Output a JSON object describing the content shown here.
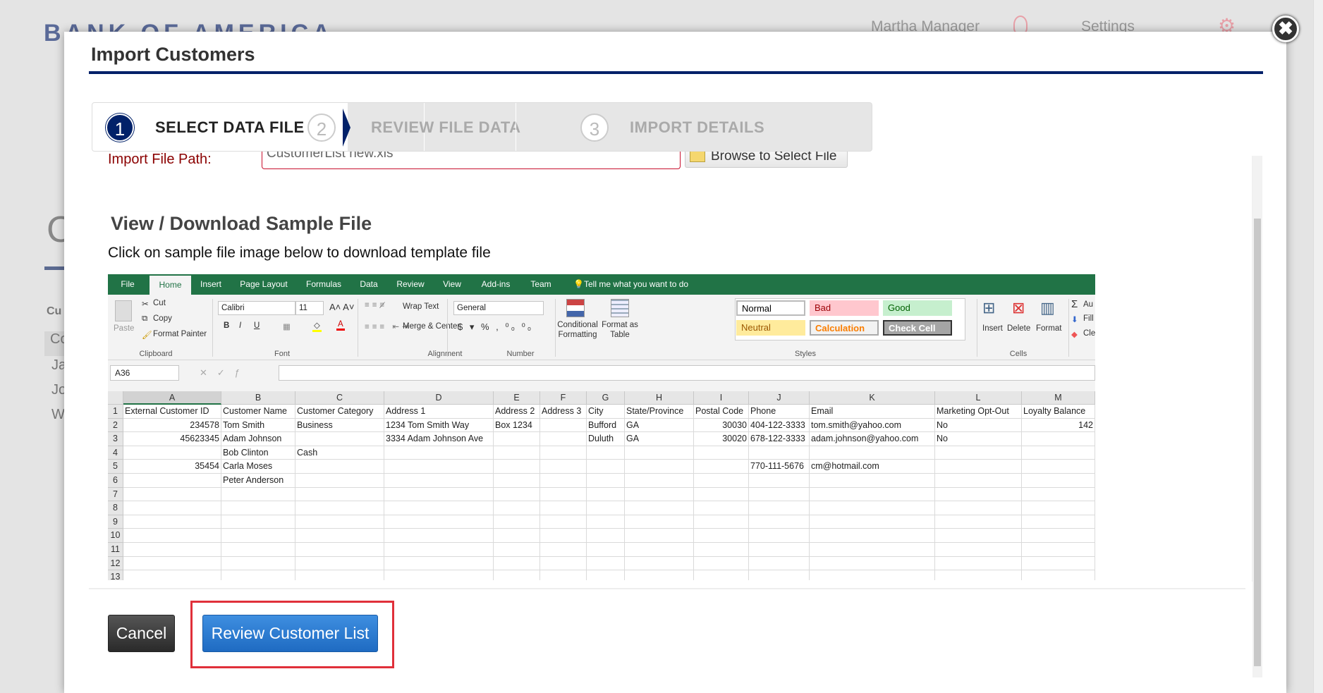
{
  "background": {
    "logo": "BANK OF AMERICA",
    "user_name": "Martha Manager",
    "settings_label": "Settings",
    "page_heading_partial": "C",
    "list_partial": [
      "Cu",
      "Co",
      "Ja",
      "Jo",
      "W"
    ]
  },
  "modal": {
    "title": "Import Customers",
    "close_label": "✖",
    "steps": [
      {
        "number": "1",
        "label": "SELECT DATA FILE",
        "active": true
      },
      {
        "number": "2",
        "label": "REVIEW FILE DATA",
        "active": false
      },
      {
        "number": "3",
        "label": "IMPORT DETAILS",
        "active": false
      }
    ],
    "import_path_label": "Import File Path:",
    "import_path_value": "CustomerList new.xls",
    "browse_label": "Browse to Select File",
    "sample_title": "View / Download Sample File",
    "sample_desc": "Click on sample file image below to download template file",
    "cancel_label": "Cancel",
    "review_label": "Review Customer List",
    "colors": {
      "navy": "#012169",
      "primary_button": "#2a7bd4",
      "highlight": "#e0303a",
      "excel_green": "#217346"
    }
  },
  "excel": {
    "tabs": [
      "File",
      "Home",
      "Insert",
      "Page Layout",
      "Formulas",
      "Data",
      "Review",
      "View",
      "Add-ins",
      "Team"
    ],
    "tell_me": "Tell me what you want to do",
    "clipboard": {
      "paste": "Paste",
      "cut": "Cut",
      "copy": "Copy",
      "format_painter": "Format Painter",
      "group": "Clipboard"
    },
    "font": {
      "name": "Calibri",
      "size": "11",
      "group": "Font"
    },
    "alignment": {
      "wrap": "Wrap Text",
      "merge": "Merge & Center",
      "group": "Alignment"
    },
    "number": {
      "format": "General",
      "group": "Number"
    },
    "styles": {
      "conditional": "Conditional Formatting",
      "format_table": "Format as Table",
      "normal": "Normal",
      "bad": "Bad",
      "good": "Good",
      "neutral": "Neutral",
      "calculation": "Calculation",
      "check_cell": "Check Cell",
      "group": "Styles"
    },
    "cells": {
      "insert": "Insert",
      "delete": "Delete",
      "format": "Format",
      "group": "Cells"
    },
    "editing": {
      "autosum": "Au",
      "fill": "Fill",
      "clear": "Cle"
    },
    "name_box": "A36",
    "columns": [
      "A",
      "B",
      "C",
      "D",
      "E",
      "F",
      "G",
      "H",
      "I",
      "J",
      "K",
      "L",
      "M"
    ],
    "row_numbers": [
      "1",
      "2",
      "3",
      "4",
      "5",
      "6",
      "7",
      "8",
      "9",
      "10",
      "11",
      "12",
      "13"
    ],
    "rows": [
      [
        "External Customer ID",
        "Customer Name",
        "Customer Category",
        "Address 1",
        "Address 2",
        "Address 3",
        "City",
        "State/Province",
        "Postal Code",
        "Phone",
        "Email",
        "Marketing Opt-Out",
        "Loyalty Balance"
      ],
      [
        "234578",
        "Tom Smith",
        "Business",
        "1234 Tom Smith Way",
        "Box 1234",
        "",
        "Bufford",
        "GA",
        "30030",
        "404-122-3333",
        "tom.smith@yahoo.com",
        "No",
        "142"
      ],
      [
        "45623345",
        "Adam Johnson",
        "",
        "3334 Adam Johnson Ave",
        "",
        "",
        "Duluth",
        "GA",
        "30020",
        "678-122-3333",
        "adam.johnson@yahoo.com",
        "No",
        ""
      ],
      [
        "",
        "Bob Clinton",
        "Cash",
        "",
        "",
        "",
        "",
        "",
        "",
        "",
        "",
        "",
        ""
      ],
      [
        "35454",
        "Carla Moses",
        "",
        "",
        "",
        "",
        "",
        "",
        "",
        "770-111-5676",
        "cm@hotmail.com",
        "",
        ""
      ],
      [
        "",
        "Peter Anderson",
        "",
        "",
        "",
        "",
        "",
        "",
        "",
        "",
        "",
        "",
        ""
      ]
    ]
  }
}
